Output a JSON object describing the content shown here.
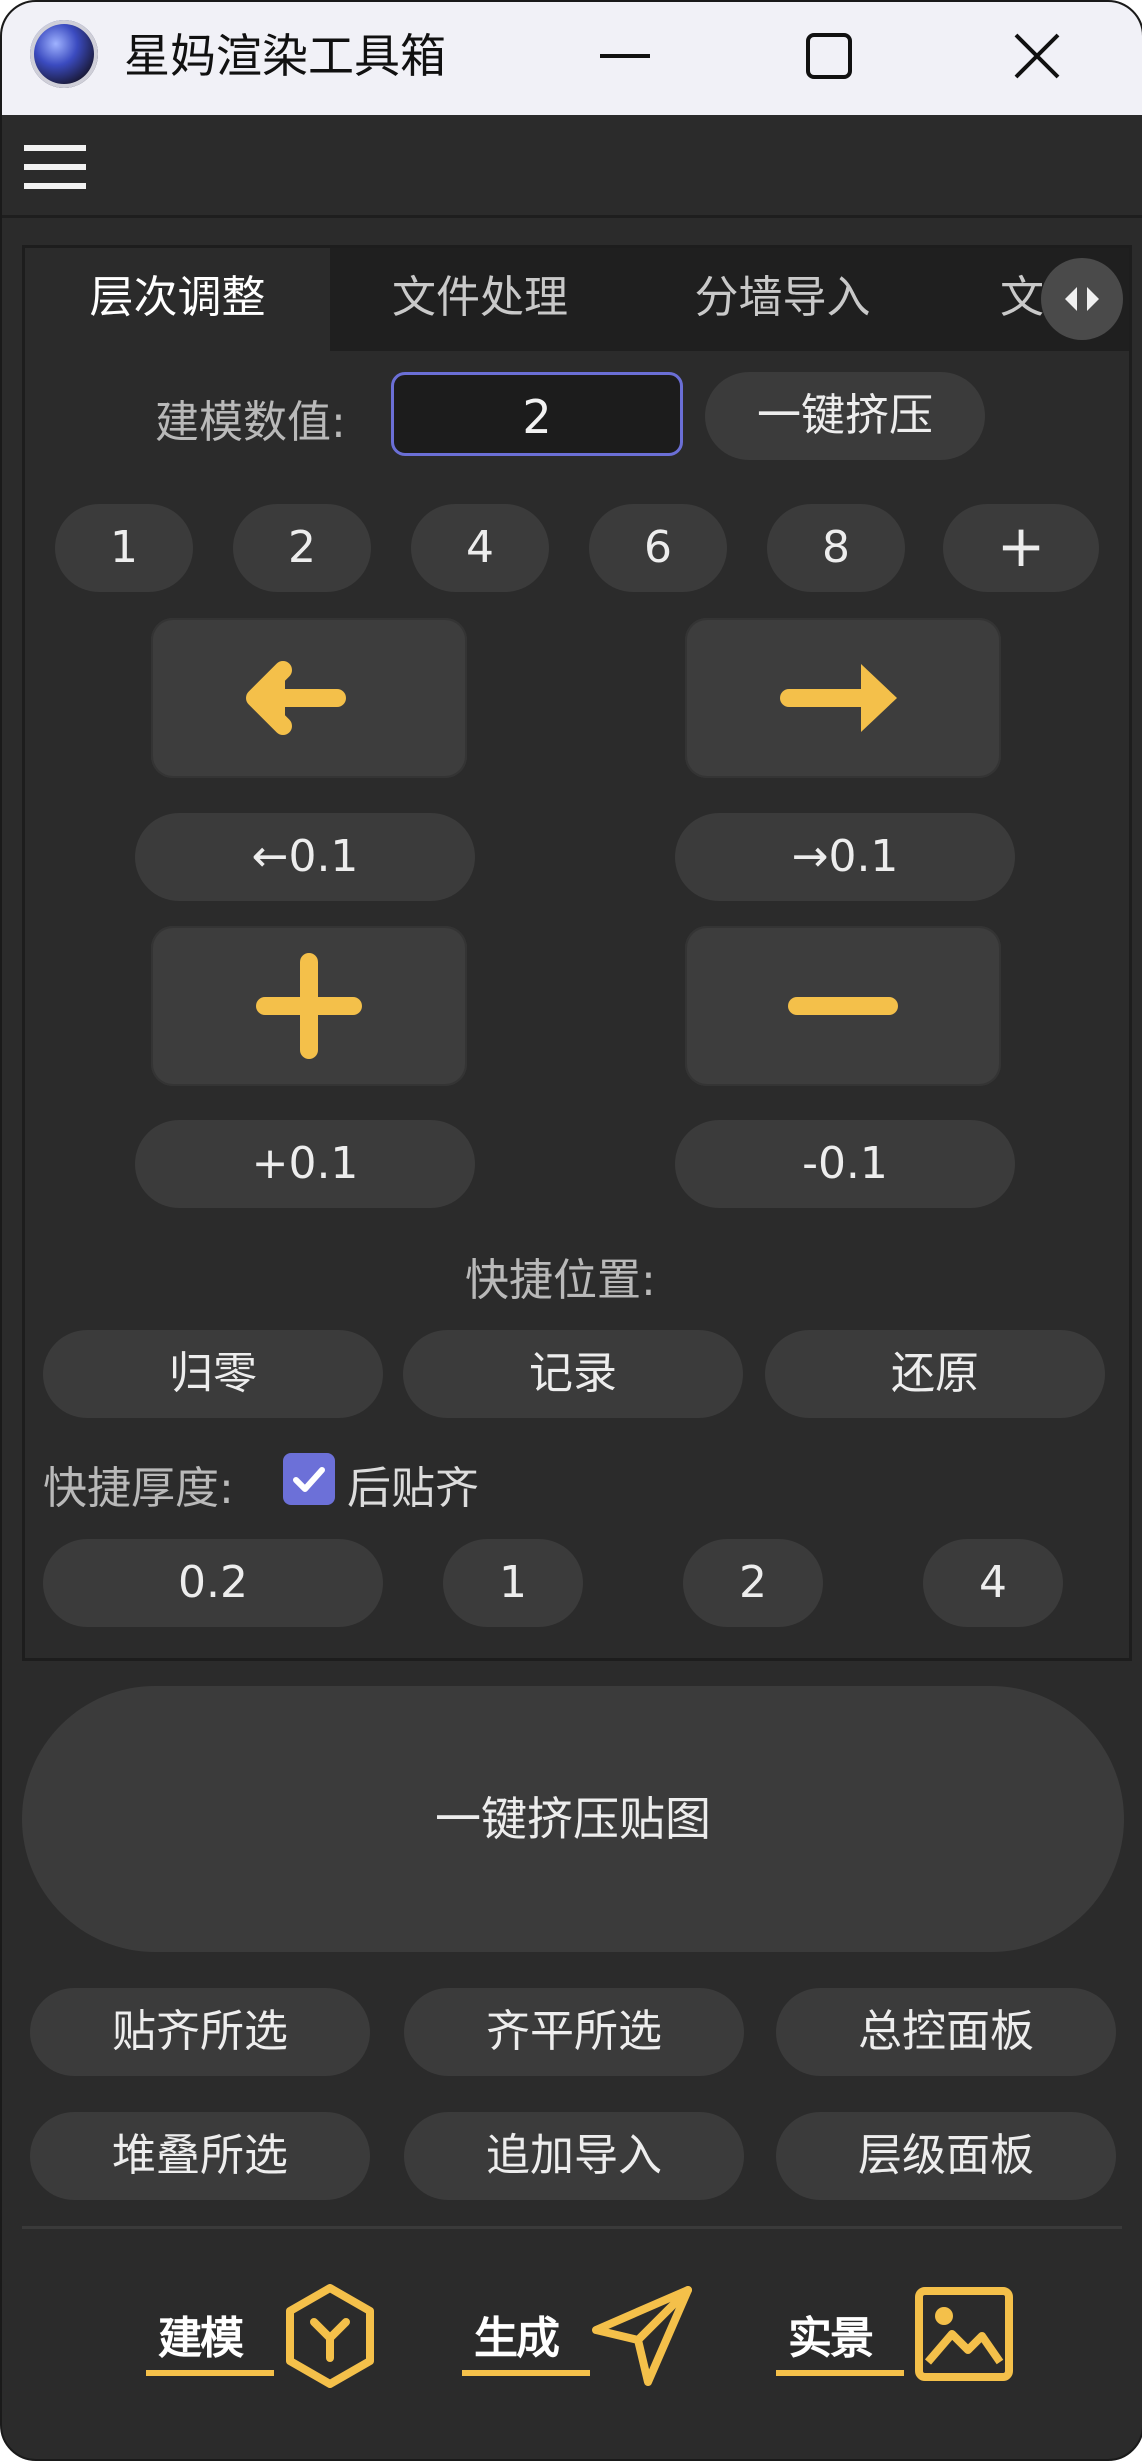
{
  "window": {
    "title": "星妈渲染工具箱"
  },
  "tabs": [
    "层次调整",
    "文件处理",
    "分墙导入",
    "文"
  ],
  "modeling": {
    "label": "建模数值:",
    "value": "2",
    "extrude_button": "一键挤压"
  },
  "presets": [
    "1",
    "2",
    "4",
    "6",
    "8",
    "+"
  ],
  "move": {
    "left_step": "←0.1",
    "right_step": "→0.1",
    "plus_step": "+0.1",
    "minus_step": "-0.1"
  },
  "quick_position": {
    "label": "快捷位置:",
    "buttons": [
      "归零",
      "记录",
      "还原"
    ]
  },
  "quick_thickness": {
    "label": "快捷厚度:",
    "checkbox_label": "后贴齐",
    "checked": true,
    "values": [
      "0.2",
      "1",
      "2",
      "4"
    ]
  },
  "big_button": "一键挤压贴图",
  "actions_row1": [
    "贴齐所选",
    "齐平所选",
    "总控面板"
  ],
  "actions_row2": [
    "堆叠所选",
    "追加导入",
    "层级面板"
  ],
  "bottom_nav": [
    {
      "label": "建模",
      "icon": "hexagon-y-icon"
    },
    {
      "label": "生成",
      "icon": "send-arrow-icon"
    },
    {
      "label": "实景",
      "icon": "image-icon"
    }
  ],
  "colors": {
    "accent_yellow": "#f4c04a",
    "accent_blue": "#6b6fd6",
    "background": "#2b2b2b"
  }
}
